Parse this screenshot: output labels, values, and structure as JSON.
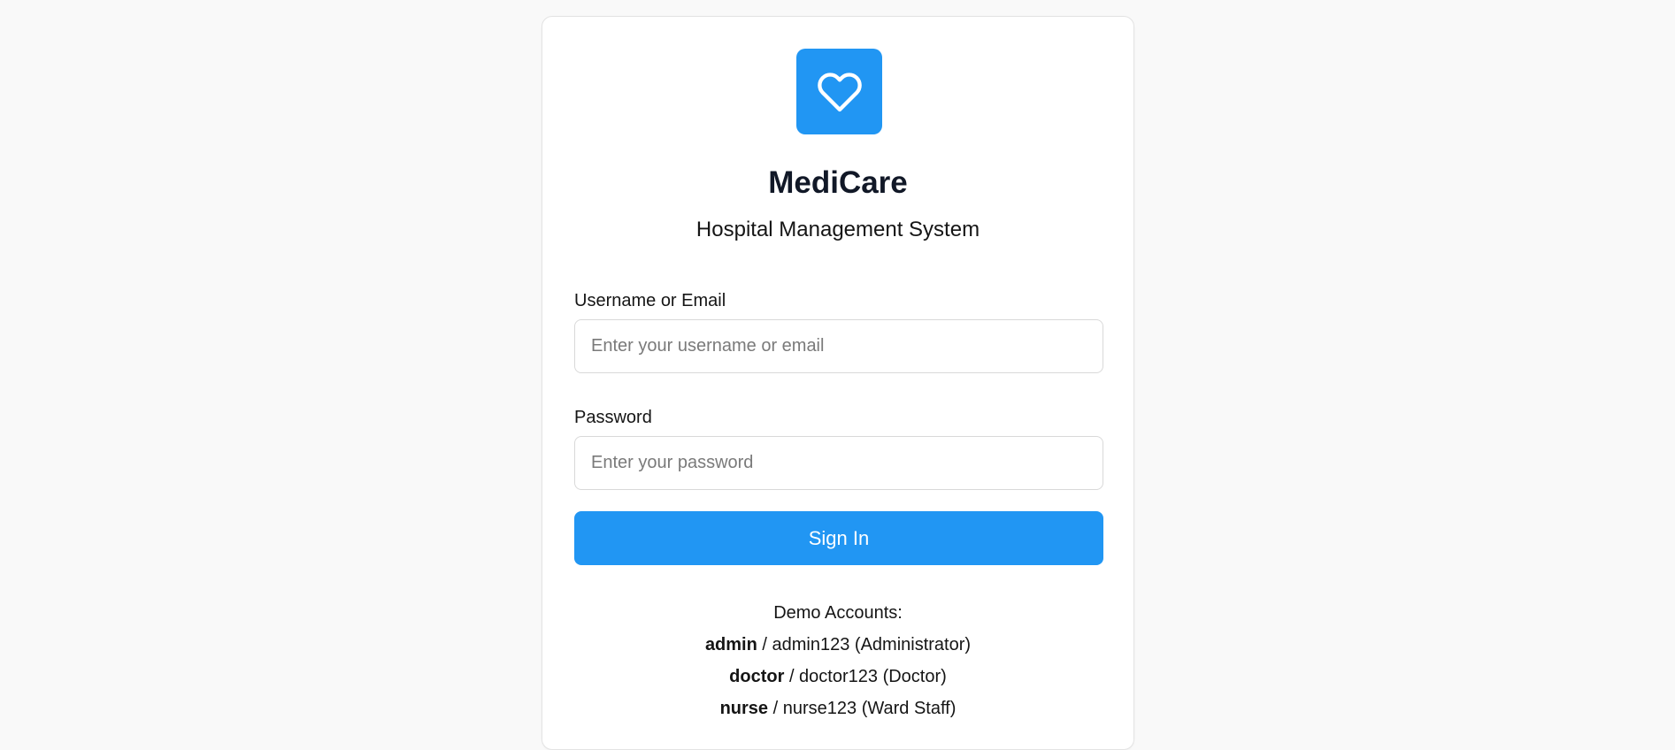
{
  "brand": {
    "title": "MediCare",
    "subtitle": "Hospital Management System",
    "icon": "heart-icon",
    "accent_color": "#2196f3"
  },
  "form": {
    "username_label": "Username or Email",
    "username_placeholder": "Enter your username or email",
    "username_value": "",
    "password_label": "Password",
    "password_placeholder": "Enter your password",
    "password_value": "",
    "submit_label": "Sign In"
  },
  "demo": {
    "heading": "Demo Accounts:",
    "accounts": [
      {
        "user": "admin",
        "rest": " / admin123 (Administrator)"
      },
      {
        "user": "doctor",
        "rest": " / doctor123 (Doctor)"
      },
      {
        "user": "nurse",
        "rest": " / nurse123 (Ward Staff)"
      }
    ]
  }
}
